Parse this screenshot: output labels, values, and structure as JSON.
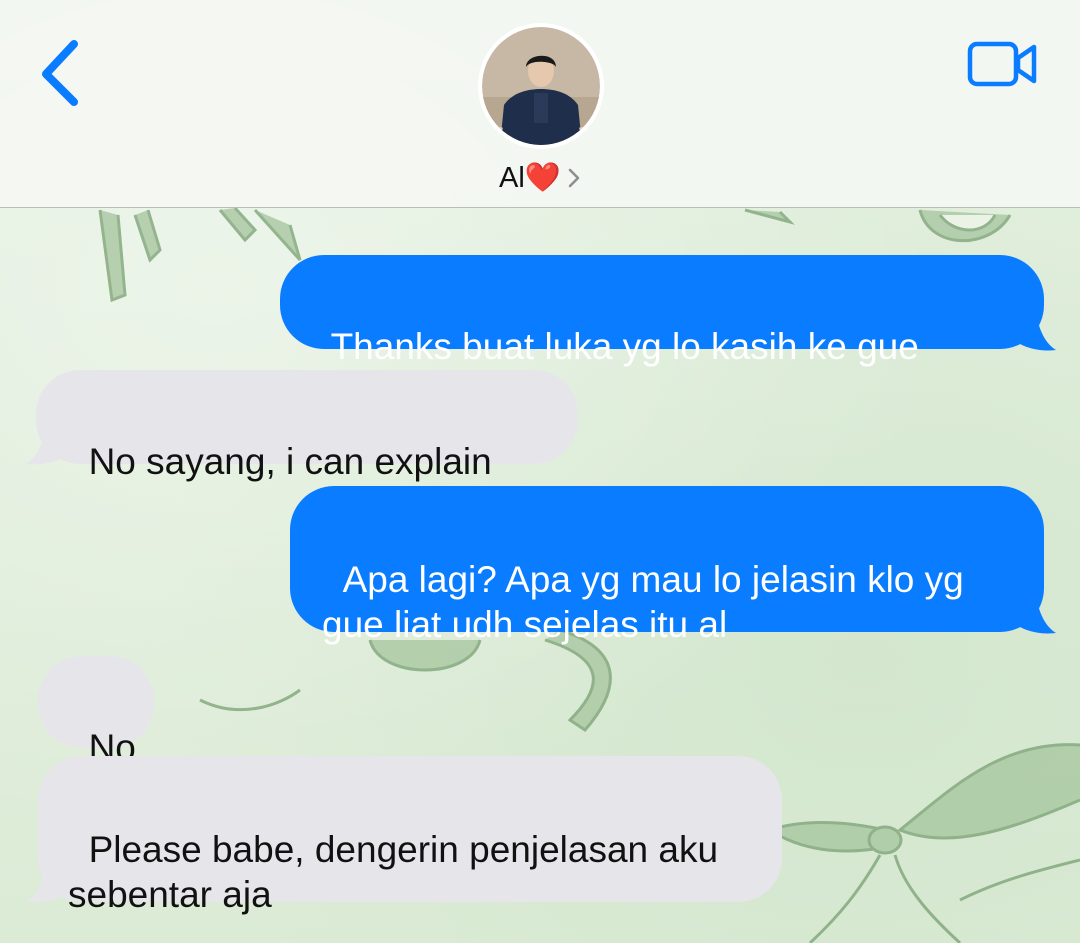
{
  "header": {
    "contact_name": "Al❤️",
    "back_icon": "chevron-left-icon",
    "video_icon": "video-camera-icon",
    "accent_color": "#0a7cff"
  },
  "messages": [
    {
      "direction": "sent",
      "text": "Thanks buat luka yg lo kasih ke gue"
    },
    {
      "direction": "received",
      "text": "No sayang, i can explain"
    },
    {
      "direction": "sent",
      "text": "Apa lagi? Apa yg mau lo jelasin klo yg gue liat udh sejelas itu al"
    },
    {
      "direction": "received",
      "text": "No"
    },
    {
      "direction": "received",
      "text": "Please babe, dengerin penjelasan aku sebentar aja"
    }
  ],
  "colors": {
    "sent_bubble": "#0a7cff",
    "received_bubble": "#e6e6ea",
    "wallpaper": "#e3efdf"
  }
}
